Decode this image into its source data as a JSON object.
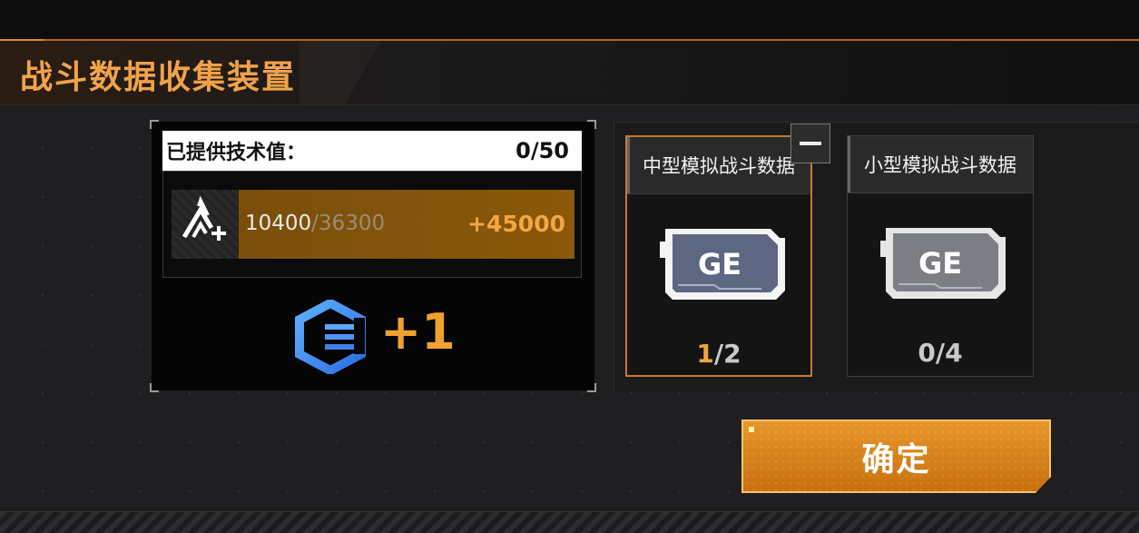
{
  "header": {
    "title": "战斗数据收集装置"
  },
  "tech": {
    "label": "已提供技术值：",
    "value": "0/50",
    "exp_current": "10400",
    "exp_total": "/36300",
    "exp_gain": "+45000",
    "exp_progress": 0.29
  },
  "reward": {
    "icon": "hexagon-level-icon",
    "count": "+1"
  },
  "cards": [
    {
      "title": "中型模拟战斗数据",
      "chip_text": "GE",
      "used": "1",
      "total": "/2",
      "selected": true
    },
    {
      "title": "小型模拟战斗数据",
      "chip_text": "GE",
      "used": "0",
      "total": "/4",
      "selected": false
    }
  ],
  "confirm": {
    "label": "确定"
  },
  "colors": {
    "accent": "#f1a24a",
    "highlight_orange": "#f2a43c",
    "confirm_bg": "#d98219"
  }
}
